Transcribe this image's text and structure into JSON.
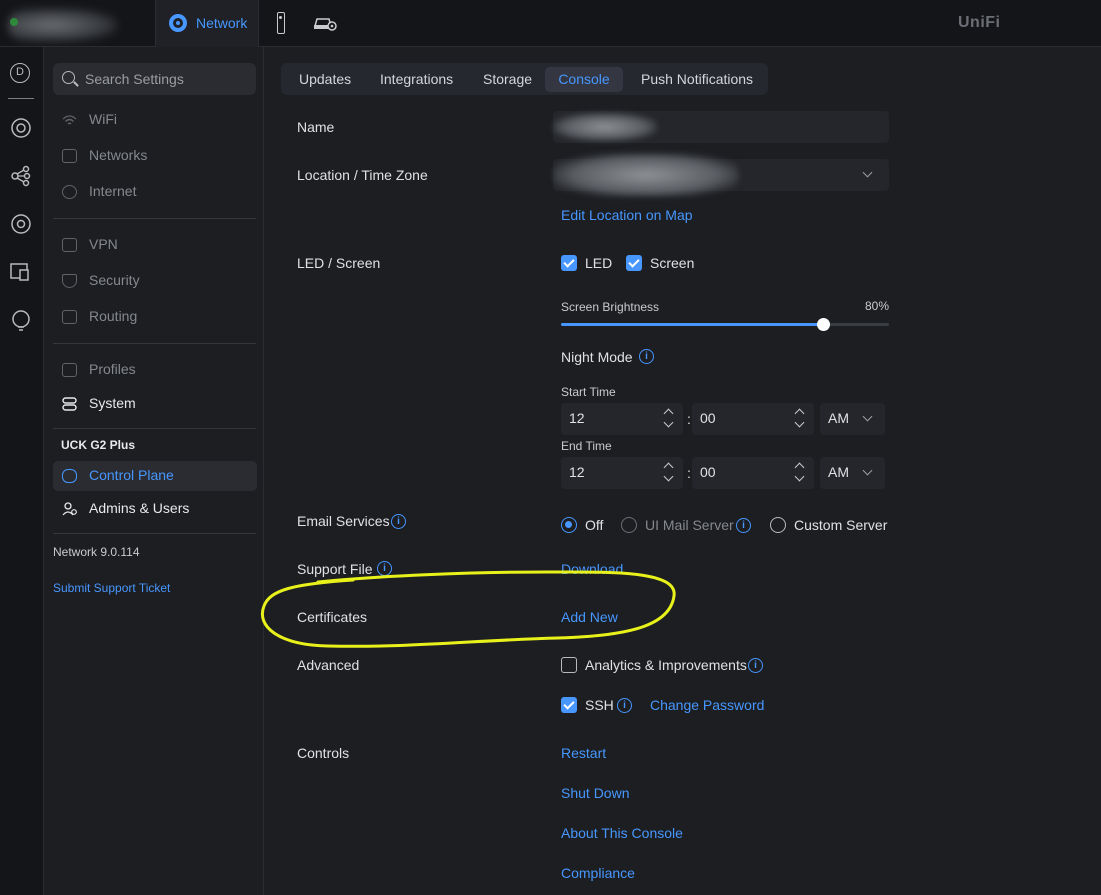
{
  "topbar": {
    "network_tab": "Network",
    "logo": "UniFi"
  },
  "rail": {
    "top_letter": "D"
  },
  "sidebar": {
    "search_placeholder": "Search Settings",
    "group1": [
      {
        "label": "WiFi",
        "icon": "wifi-icon"
      },
      {
        "label": "Networks",
        "icon": "networks-icon"
      },
      {
        "label": "Internet",
        "icon": "globe-icon"
      }
    ],
    "group2": [
      {
        "label": "VPN",
        "icon": "vpn-icon"
      },
      {
        "label": "Security",
        "icon": "shield-icon"
      },
      {
        "label": "Routing",
        "icon": "routing-icon"
      }
    ],
    "group3": [
      {
        "label": "Profiles",
        "icon": "profiles-icon"
      },
      {
        "label": "System",
        "icon": "system-icon"
      }
    ],
    "device_heading": "UCK G2 Plus",
    "device_items": [
      {
        "label": "Control Plane",
        "icon": "control-plane-icon",
        "active": true
      },
      {
        "label": "Admins & Users",
        "icon": "admins-icon"
      }
    ],
    "version": "Network 9.0.114",
    "support_link": "Submit Support Ticket"
  },
  "tabs": [
    "Updates",
    "Integrations",
    "Storage",
    "Console",
    "Push Notifications"
  ],
  "tabs_selected": "Console",
  "form": {
    "name_label": "Name",
    "location_label": "Location / Time Zone",
    "edit_location_link": "Edit Location on Map",
    "led_label": "LED / Screen",
    "led_checkbox": "LED",
    "screen_checkbox": "Screen",
    "brightness_label": "Screen Brightness",
    "brightness_value": "80%",
    "brightness_level": 0.8,
    "night_mode_label": "Night Mode",
    "start_time_label": "Start Time",
    "start_hour": "12",
    "start_minute": "00",
    "start_ampm": "AM",
    "end_time_label": "End Time",
    "end_hour": "12",
    "end_minute": "00",
    "end_ampm": "AM",
    "colon": ":",
    "email_label": "Email Services",
    "email_off": "Off",
    "email_ui_mail": "UI Mail Server",
    "email_custom": "Custom Server",
    "support_label": "Support File",
    "support_download": "Download",
    "certificates_label": "Certificates",
    "certificates_add": "Add New",
    "advanced_label": "Advanced",
    "analytics_label": "Analytics & Improvements",
    "ssh_label": "SSH",
    "change_password": "Change Password",
    "controls_label": "Controls",
    "restart": "Restart",
    "shutdown": "Shut Down",
    "about": "About This Console",
    "compliance": "Compliance"
  },
  "colors": {
    "accent": "#4797ff",
    "annotation": "#e8f21a"
  }
}
